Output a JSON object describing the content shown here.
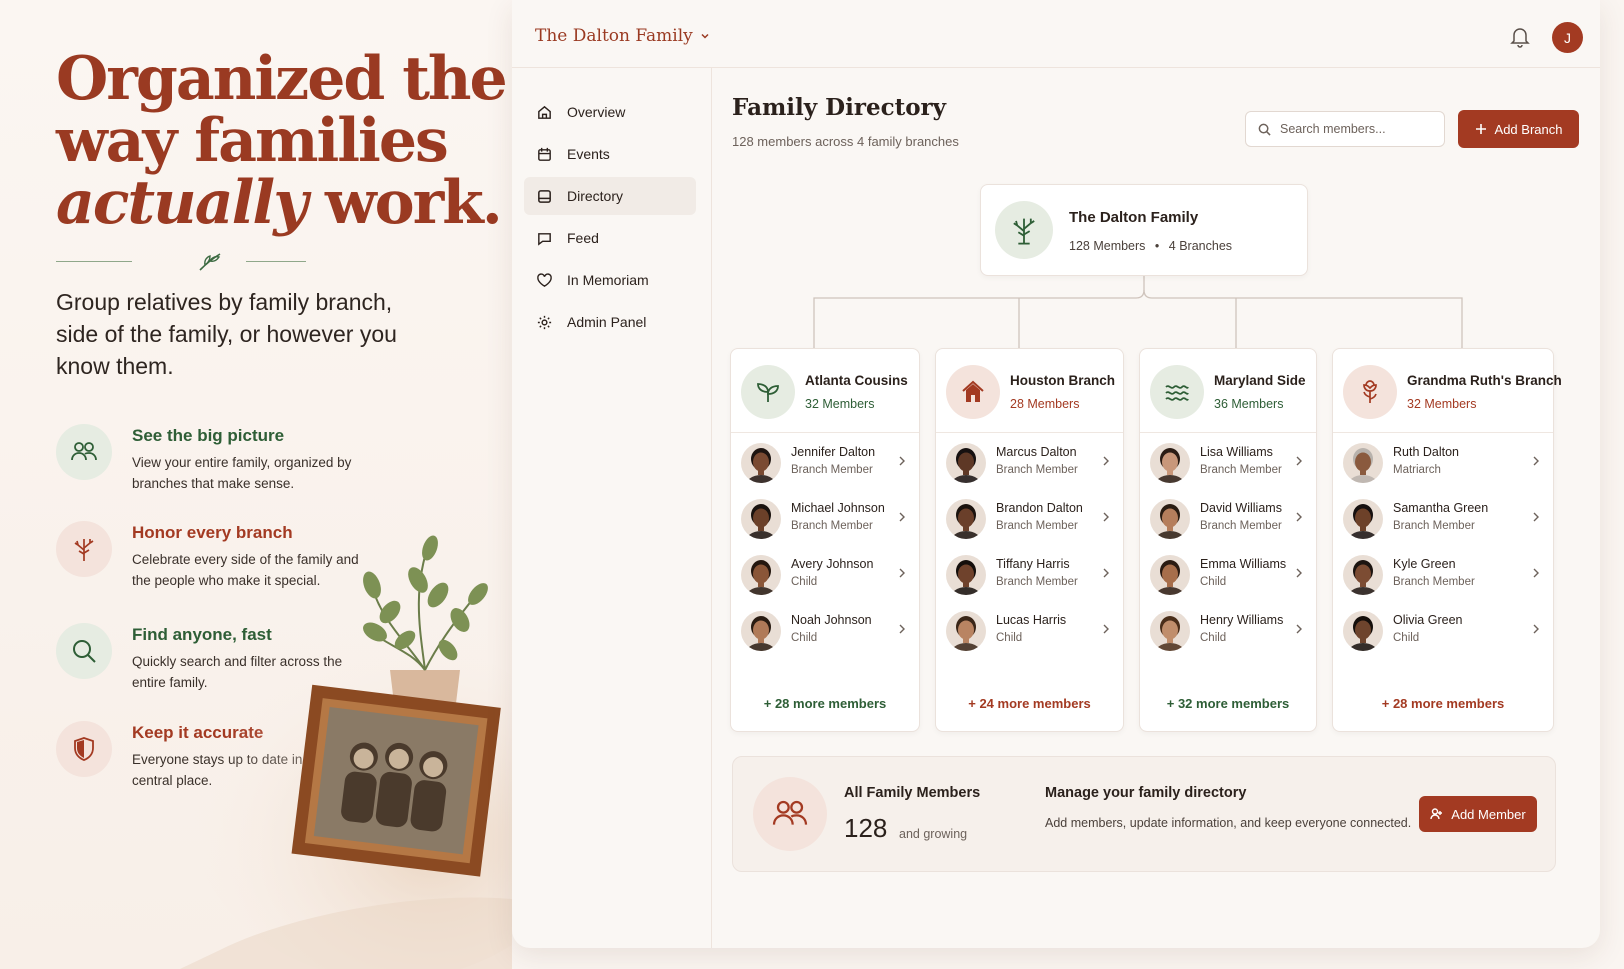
{
  "marketing": {
    "headline_line1": "Organized the",
    "headline_line2": "way families",
    "headline_em": "actually",
    "headline_end": " work.",
    "tagline": "Group relatives by family branch, side of the family, or however you know them.",
    "features": [
      {
        "title": "See the big picture",
        "desc": "View your entire family, organized by branches that make sense.",
        "icon": "people-icon",
        "tone": "green"
      },
      {
        "title": "Honor every branch",
        "desc": "Celebrate every side of the family and the people who make it special.",
        "icon": "tree-icon",
        "tone": "red"
      },
      {
        "title": "Find anyone, fast",
        "desc": "Quickly search and filter across the entire family.",
        "icon": "search-icon",
        "tone": "green"
      },
      {
        "title": "Keep it accurate",
        "desc": "Everyone stays up to date in one central place.",
        "icon": "shield-icon",
        "tone": "red"
      }
    ]
  },
  "app": {
    "family_name": "The Dalton Family",
    "user_initial": "J",
    "nav": [
      {
        "label": "Overview",
        "icon": "home-icon"
      },
      {
        "label": "Events",
        "icon": "calendar-icon"
      },
      {
        "label": "Directory",
        "icon": "directory-icon",
        "active": true
      },
      {
        "label": "Feed",
        "icon": "chat-icon"
      },
      {
        "label": "In Memoriam",
        "icon": "heart-icon"
      },
      {
        "label": "Admin Panel",
        "icon": "gear-icon"
      }
    ],
    "page_title": "Family Directory",
    "page_subtitle": "128 members across 4 family branches",
    "search_placeholder": "Search members...",
    "add_branch_label": "Add Branch",
    "root": {
      "name": "The Dalton Family",
      "members": "128 Members",
      "branches": "4 Branches"
    },
    "branches": [
      {
        "name": "Atlanta Cousins",
        "count": "32 Members",
        "tone": "green",
        "icon": "sprout-icon",
        "more": "+ 28 more members",
        "members": [
          {
            "name": "Jennifer Dalton",
            "role": "Branch Member",
            "skin": "#7a4a32",
            "hair": "#1e1410"
          },
          {
            "name": "Michael Johnson",
            "role": "Branch Member",
            "skin": "#6b4029",
            "hair": "#1a120e"
          },
          {
            "name": "Avery Johnson",
            "role": "Child",
            "skin": "#8a5638",
            "hair": "#24170f"
          },
          {
            "name": "Noah Johnson",
            "role": "Child",
            "skin": "#b07a58",
            "hair": "#2a1c12"
          }
        ]
      },
      {
        "name": "Houston Branch",
        "count": "28 Members",
        "tone": "red",
        "icon": "house-icon",
        "more": "+ 24 more members",
        "members": [
          {
            "name": "Marcus Dalton",
            "role": "Branch Member",
            "skin": "#5e3826",
            "hair": "#161010"
          },
          {
            "name": "Brandon Dalton",
            "role": "Branch Member",
            "skin": "#6a3f2a",
            "hair": "#1a120e"
          },
          {
            "name": "Tiffany Harris",
            "role": "Branch Member",
            "skin": "#6f422c",
            "hair": "#140e0b"
          },
          {
            "name": "Lucas Harris",
            "role": "Child",
            "skin": "#b98462",
            "hair": "#3a2618"
          }
        ]
      },
      {
        "name": "Maryland Side",
        "count": "36 Members",
        "tone": "green",
        "icon": "waves-icon",
        "more": "+ 32 more members",
        "members": [
          {
            "name": "Lisa Williams",
            "role": "Branch Member",
            "skin": "#c8977a",
            "hair": "#2a1c14"
          },
          {
            "name": "David Williams",
            "role": "Branch Member",
            "skin": "#b57e5c",
            "hair": "#2a1c12"
          },
          {
            "name": "Emma Williams",
            "role": "Child",
            "skin": "#a76e4b",
            "hair": "#2b1b12"
          },
          {
            "name": "Henry Williams",
            "role": "Child",
            "skin": "#c08e6c",
            "hair": "#4a2e1a"
          }
        ]
      },
      {
        "name": "Grandma Ruth's Branch",
        "count": "32 Members",
        "tone": "red",
        "icon": "flower-icon",
        "more": "+ 28 more members",
        "members": [
          {
            "name": "Ruth Dalton",
            "role": "Matriarch",
            "skin": "#8a5a3e",
            "hair": "#b8b2ac"
          },
          {
            "name": "Samantha Green",
            "role": "Branch Member",
            "skin": "#6d4129",
            "hair": "#161010"
          },
          {
            "name": "Kyle Green",
            "role": "Branch Member",
            "skin": "#7c4c33",
            "hair": "#1c1410"
          },
          {
            "name": "Olivia Green",
            "role": "Child",
            "skin": "#6e442d",
            "hair": "#140e0b"
          }
        ]
      }
    ],
    "summary": {
      "label": "All Family Members",
      "count": "128",
      "growing": "and growing",
      "manage_title": "Manage your family directory",
      "manage_desc": "Add members, update information, and keep everyone connected.",
      "add_member_label": "Add Member"
    },
    "colors": {
      "accent": "#a33a22",
      "green": "#2e5e36"
    }
  }
}
